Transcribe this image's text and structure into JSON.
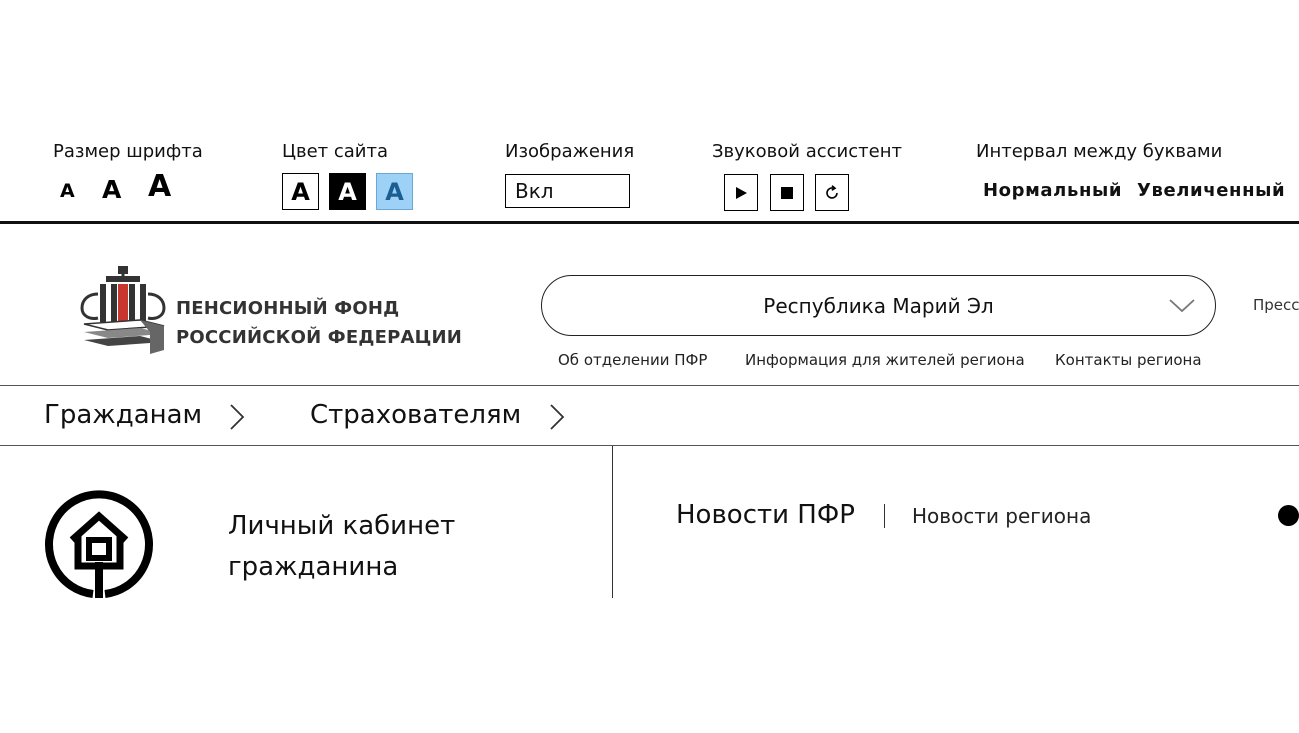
{
  "accessibility": {
    "font_size": {
      "label": "Размер шрифта",
      "options": [
        "А",
        "А",
        "А"
      ]
    },
    "site_color": {
      "label": "Цвет сайта",
      "options": [
        "А",
        "А",
        "А"
      ]
    },
    "images": {
      "label": "Изображения",
      "value": "Вкл"
    },
    "sound_assistant": {
      "label": "Звуковой ассистент",
      "buttons": [
        "▶",
        "■",
        "↻"
      ]
    },
    "letter_spacing": {
      "label": "Интервал между буквами",
      "options": [
        "Нормальный",
        "Увеличенный"
      ]
    }
  },
  "header": {
    "logo_line1": "ПЕНСИОННЫЙ ФОНД",
    "logo_line2": "РОССИЙСКОЙ ФЕДЕРАЦИИ",
    "region": "Республика Марий Эл",
    "press": "Пресс",
    "sub_links": [
      "Об отделении  ПФР",
      "Информация для жителей региона",
      "Контакты региона"
    ]
  },
  "main_nav": [
    "Гражданам",
    "Страхователям"
  ],
  "content": {
    "cabinet_line1": "Личный кабинет",
    "cabinet_line2": "гражданина",
    "news_tabs": [
      "Новости ПФР",
      "Новости региона"
    ]
  },
  "colors": {
    "blue_theme_bg": "#9dd1f5",
    "blue_theme_text": "#1b5f92",
    "logo_red": "#c7372f",
    "text": "#111111"
  }
}
